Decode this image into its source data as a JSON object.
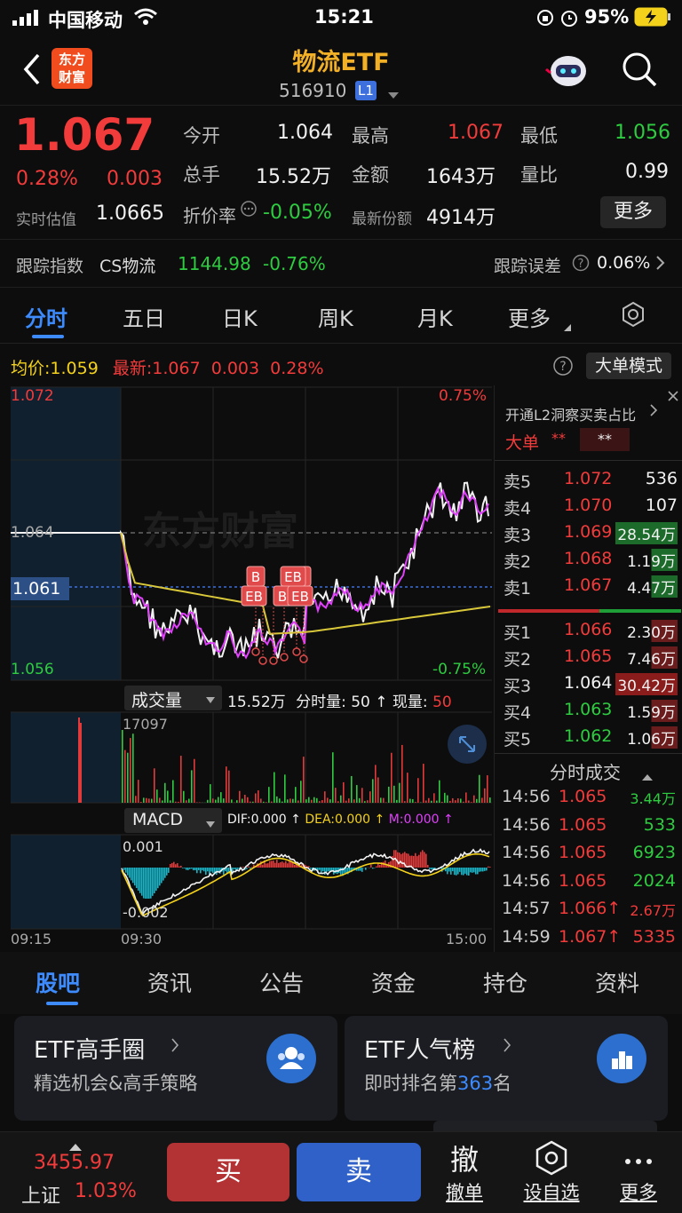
{
  "status": {
    "carrier": "中国移动",
    "time": "15:21",
    "battery": "95%"
  },
  "nav": {
    "logo_line1": "东方",
    "logo_line2": "财富",
    "title": "物流ETF",
    "code": "516910",
    "level": "L1"
  },
  "quote": {
    "price": "1.067",
    "change_pct": "0.28%",
    "change": "0.003",
    "est_label": "实时估值",
    "est_value": "1.0665",
    "open_label": "今开",
    "open": "1.064",
    "high_label": "最高",
    "high": "1.067",
    "low_label": "最低",
    "low": "1.056",
    "vol_label": "总手",
    "vol": "15.52万",
    "amount_label": "金额",
    "amount": "1643万",
    "ratio_label": "量比",
    "ratio": "0.99",
    "discount_label": "折价率",
    "discount": "-0.05%",
    "shares_label": "最新份额",
    "shares": "4914万",
    "more_label": "更多",
    "track_label": "跟踪指数",
    "track_index": "CS物流",
    "track_value": "1144.98",
    "track_change": "-0.76%",
    "err_label": "跟踪误差",
    "err_value": "0.06%"
  },
  "tabs": [
    "分时",
    "五日",
    "日K",
    "周K",
    "月K",
    "更多"
  ],
  "chart": {
    "avg_label": "均价:",
    "avg_value": "1.059",
    "last_label": "最新:",
    "last_value": "1.067",
    "last_change": "0.003",
    "last_pct": "0.28%",
    "big_mode": "大单模式",
    "y_top": "1.072",
    "y_mid": "1.064",
    "y_cur": "1.061",
    "y_bot": "1.056",
    "pct_top": "0.75%",
    "pct_bot": "-0.75%",
    "vol_btn": "成交量",
    "vol_total": "15.52万",
    "vol_minute_label": "分时量:",
    "vol_minute": "50",
    "vol_now_label": "现量:",
    "vol_now": "50",
    "vol_max": "17097",
    "macd_btn": "MACD",
    "dif": "DIF:0.000",
    "dea": "DEA:0.000",
    "m": "M:0.000",
    "macd_top": "0.001",
    "macd_bot": "-0.002",
    "t_start": "09:15",
    "t_open": "09:30",
    "t_end": "15:00",
    "watermark": "东方财富",
    "marks": [
      "B",
      "EB",
      "B",
      "B",
      "EB",
      "EB"
    ]
  },
  "orderbook": {
    "promo": "开通L2洞察买卖占比",
    "big_label": "大单",
    "big_v1": "**",
    "big_v2": "**",
    "asks": [
      {
        "label": "卖5",
        "price": "1.072",
        "vol": "536"
      },
      {
        "label": "卖4",
        "price": "1.070",
        "vol": "107"
      },
      {
        "label": "卖3",
        "price": "1.069",
        "vol": "28.54万"
      },
      {
        "label": "卖2",
        "price": "1.068",
        "vol": "1.19万"
      },
      {
        "label": "卖1",
        "price": "1.067",
        "vol": "4.47万"
      }
    ],
    "bids": [
      {
        "label": "买1",
        "price": "1.066",
        "vol": "2.30万"
      },
      {
        "label": "买2",
        "price": "1.065",
        "vol": "7.46万"
      },
      {
        "label": "买3",
        "price": "1.064",
        "vol": "30.42万"
      },
      {
        "label": "买4",
        "price": "1.063",
        "vol": "1.59万"
      },
      {
        "label": "买5",
        "price": "1.062",
        "vol": "1.06万"
      }
    ],
    "ticks_title": "分时成交",
    "ticks": [
      {
        "time": "14:56",
        "price": "1.065",
        "vol": "3.44万"
      },
      {
        "time": "14:56",
        "price": "1.065",
        "vol": "533"
      },
      {
        "time": "14:56",
        "price": "1.065",
        "vol": "6923"
      },
      {
        "time": "14:56",
        "price": "1.065",
        "vol": "2024"
      },
      {
        "time": "14:57",
        "price": "1.066↑",
        "vol": "2.67万"
      },
      {
        "time": "14:59",
        "price": "1.067↑",
        "vol": "5335"
      }
    ]
  },
  "bottom_tabs": [
    "股吧",
    "资讯",
    "公告",
    "资金",
    "持仓",
    "资料"
  ],
  "cards": [
    {
      "title": "ETF高手圈",
      "sub": "精选机会&高手策略"
    },
    {
      "title": "ETF人气榜",
      "sub_prefix": "即时排名第",
      "rank": "363",
      "sub_suffix": "名"
    }
  ],
  "bottombar": {
    "index_value": "3455.97",
    "index_name": "上证",
    "index_pct": "1.03%",
    "buy": "买",
    "sell": "卖",
    "cancel_icon": "撤",
    "cancel": "撤单",
    "watch": "设自选",
    "more": "更多"
  },
  "colors": {
    "up": "#f23b3b",
    "down": "#2ecc40",
    "avg": "#f4d21c",
    "macd_dea": "#e040fb",
    "accent": "#3d8bfd"
  }
}
